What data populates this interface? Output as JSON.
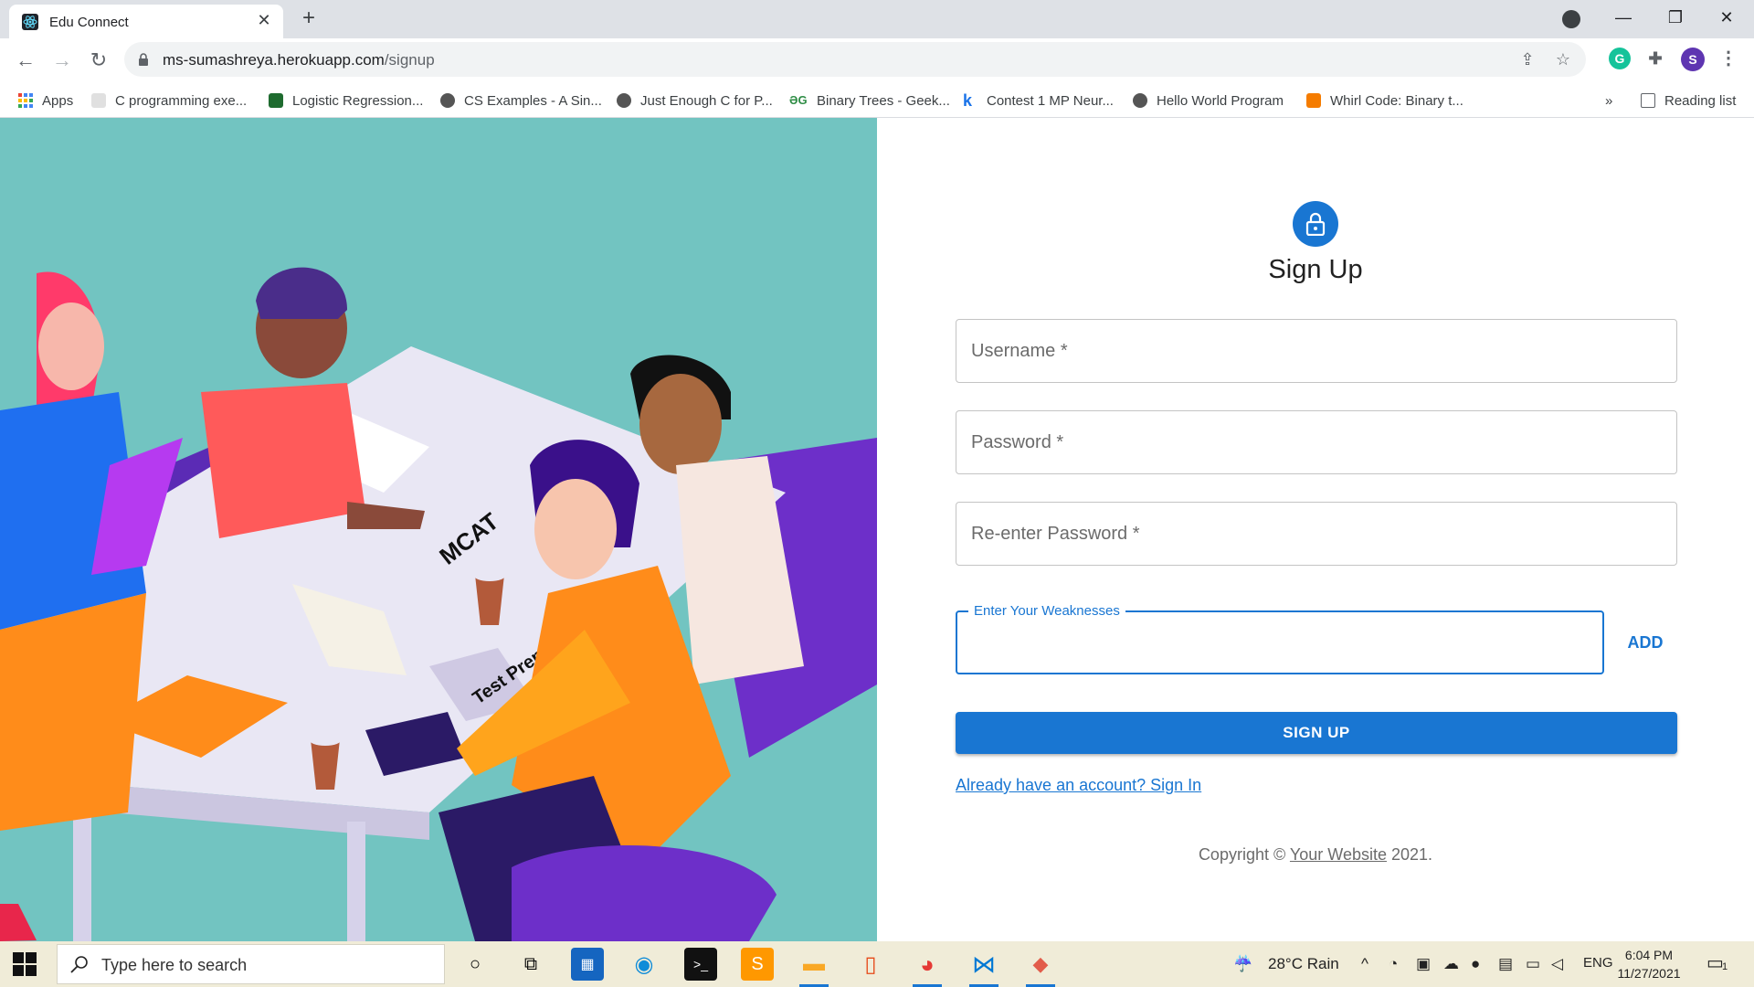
{
  "browser": {
    "tab_title": "Edu Connect",
    "url_host": "ms-sumashreya.herokuapp.com",
    "url_path": "/signup",
    "profile_initial": "S",
    "bookmarks": [
      {
        "label": "Apps",
        "icon": "apps-grid-icon",
        "color": "#4285f4"
      },
      {
        "label": "C programming exe...",
        "icon": "w3r-icon",
        "color": "#bbbbbb"
      },
      {
        "label": "Logistic Regression...",
        "icon": "ml-icon",
        "color": "#1e6b2f"
      },
      {
        "label": "CS Examples - A Sin...",
        "icon": "globe-icon",
        "color": "#555555"
      },
      {
        "label": "Just Enough C for P...",
        "icon": "globe-icon",
        "color": "#555555"
      },
      {
        "label": "Binary Trees - Geek...",
        "icon": "gfg-icon",
        "color": "#2f8d46"
      },
      {
        "label": "Contest 1 MP Neur...",
        "icon": "k-icon",
        "color": "#1a73e8"
      },
      {
        "label": "Hello World Program",
        "icon": "globe-icon",
        "color": "#555555"
      },
      {
        "label": "Whirl Code: Binary t...",
        "icon": "blogger-icon",
        "color": "#f57c00"
      }
    ],
    "bookmarks_overflow": "»",
    "reading_list": "Reading list"
  },
  "form": {
    "title": "Sign Up",
    "username_placeholder": "Username *",
    "password_placeholder": "Password *",
    "reenter_placeholder": "Re-enter Password *",
    "weakness_label": "Enter Your Weaknesses",
    "add_label": "ADD",
    "signup_label": "SIGN UP",
    "signin_link": "Already have an account? Sign In",
    "copyright_prefix": "Copyright © ",
    "copyright_link": "Your Website",
    "copyright_suffix": " 2021."
  },
  "colors": {
    "primary": "#1976d2",
    "illustration_bg": "#72c4c1"
  },
  "illustration": {
    "paper_text_1": "MCAT",
    "paper_text_2": "Test Prep"
  },
  "taskbar": {
    "search_placeholder": "Type here to search",
    "weather": "28°C  Rain",
    "language": "ENG",
    "time": "6:04 PM",
    "date": "11/27/2021",
    "notification_count": "1"
  }
}
